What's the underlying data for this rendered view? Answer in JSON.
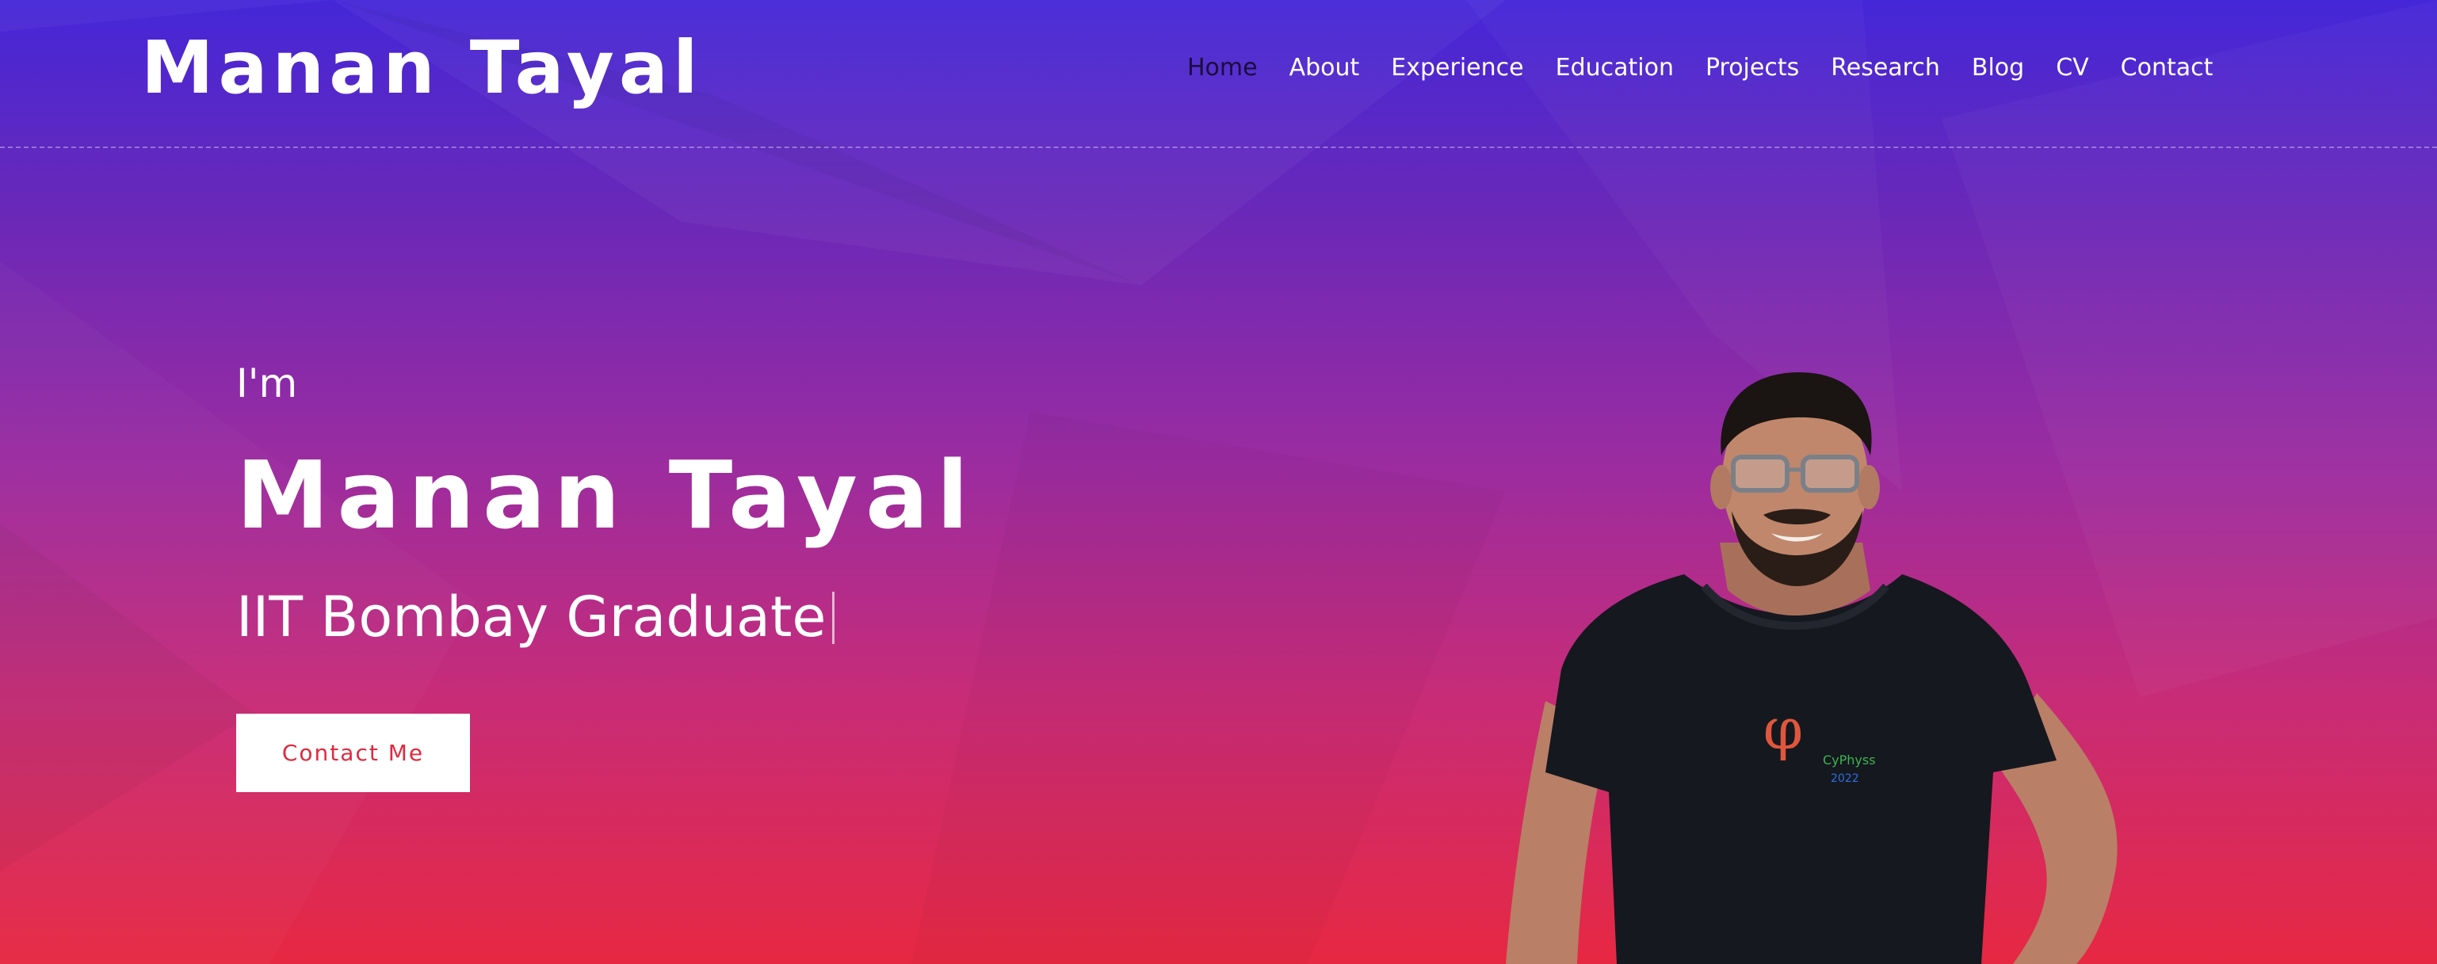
{
  "header": {
    "brand": "Manan Tayal",
    "nav": [
      {
        "label": "Home",
        "active": true
      },
      {
        "label": "About"
      },
      {
        "label": "Experience"
      },
      {
        "label": "Education"
      },
      {
        "label": "Projects"
      },
      {
        "label": "Research"
      },
      {
        "label": "Blog"
      },
      {
        "label": "CV"
      },
      {
        "label": "Contact"
      }
    ]
  },
  "hero": {
    "intro": "I'm",
    "name": "Manan Tayal",
    "subtitle": "IIT Bombay Graduate",
    "cta_label": "Contact Me",
    "portrait_alt": "Manan Tayal",
    "shirt_text": "CyPhyss",
    "shirt_year": "2022"
  },
  "colors": {
    "gradient_top": "#4427d8",
    "gradient_bottom": "#e72842",
    "cta_text": "#df2a3e",
    "nav_active": "#1b0d3a"
  }
}
